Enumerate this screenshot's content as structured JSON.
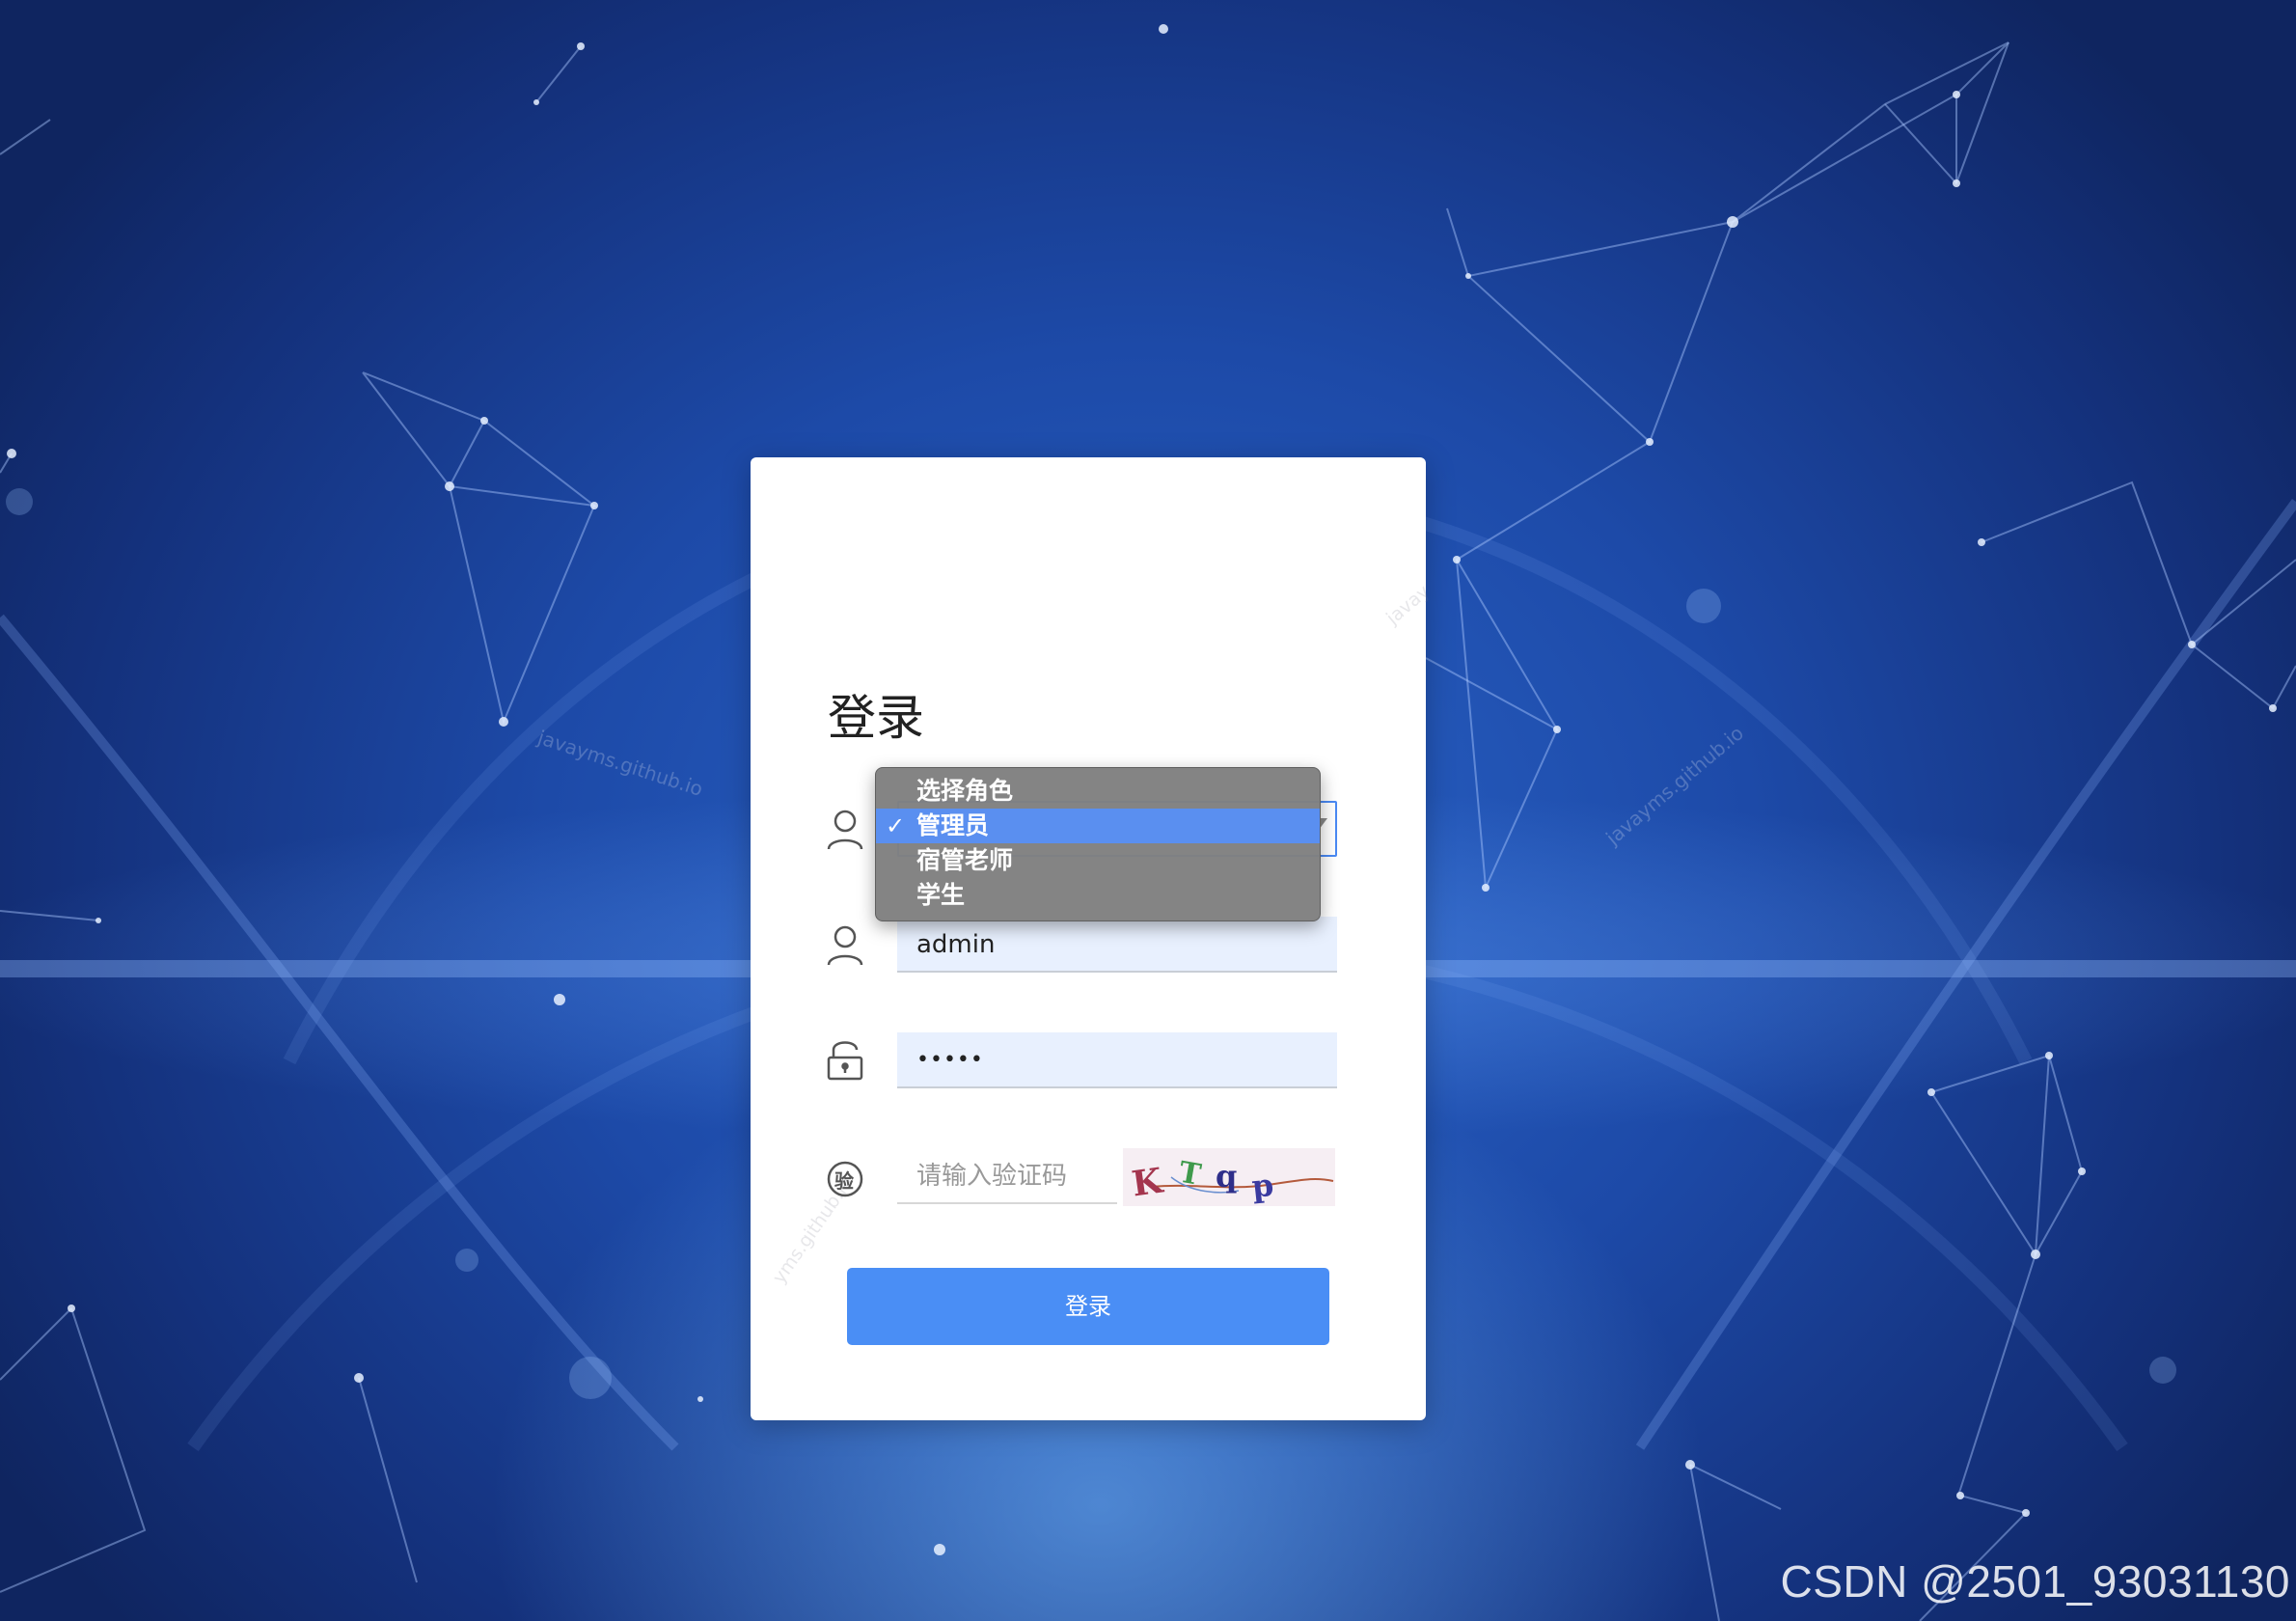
{
  "login": {
    "title": "登录",
    "role_select": {
      "selected": "管理员",
      "options": [
        "选择角色",
        "管理员",
        "宿管老师",
        "学生"
      ],
      "selected_index": 1
    },
    "username": {
      "value": "admin"
    },
    "password": {
      "value": "•••••"
    },
    "captcha": {
      "placeholder": "请输入验证码",
      "image_text": "KTqp",
      "icon_char": "验"
    },
    "submit_label": "登录"
  },
  "watermarks": {
    "site": "javayms.github.io",
    "partial_top": "javay",
    "partial_left": "yms.github.io"
  },
  "footer": {
    "credit": "CSDN @2501_93031130"
  },
  "colors": {
    "background": "#1d4aa8",
    "card": "#ffffff",
    "primary": "#4a8ef5",
    "input_fill": "#e8f0fe",
    "dropdown_bg": "#808080",
    "dropdown_selected": "#5a8ff0"
  },
  "icons": [
    "user-icon",
    "lock-icon",
    "captcha-badge-icon",
    "check-icon",
    "chevron-down-icon"
  ]
}
